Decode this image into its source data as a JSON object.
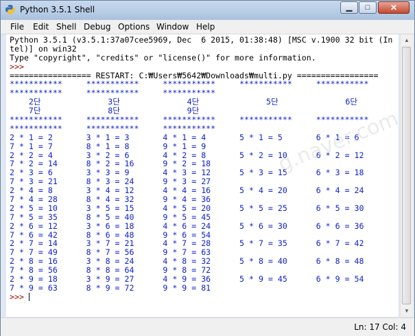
{
  "window": {
    "title": "Python 3.5.1 Shell"
  },
  "controls": {
    "minimize": "▁",
    "maximize": "□",
    "close": "✕"
  },
  "menu": [
    "File",
    "Edit",
    "Shell",
    "Debug",
    "Options",
    "Window",
    "Help"
  ],
  "watermark": "g.naver.com/nc",
  "console": [
    {
      "text": "Python 3.5.1 (v3.5.1:37a07cee5969, Dec  6 2015, 01:38:48) [MSC v.1900 32 bit (In",
      "style": "plain"
    },
    {
      "text": "tel)] on win32",
      "style": "plain"
    },
    {
      "text": "Type \"copyright\", \"credits\" or \"license()\" for more information.",
      "style": "plain"
    },
    {
      "text": ">>> ",
      "style": "prompt"
    },
    {
      "text": "================= RESTART: C:₩Users₩5642₩Downloads₩multi.py =================",
      "style": "plain"
    },
    {
      "text": "***********     ***********     ***********     ***********     ***********",
      "style": "out"
    },
    {
      "text": "***********     ***********     ***********",
      "style": "out"
    },
    {
      "text": "    2단              3단              4단              5단              6단",
      "style": "out"
    },
    {
      "text": "    7단              8단              9단",
      "style": "out"
    },
    {
      "text": "***********     ***********     ***********     ***********     ***********",
      "style": "out"
    },
    {
      "text": "***********     ***********     ***********",
      "style": "out"
    },
    {
      "text": "2 * 1 = 2       3 * 1 = 3       4 * 1 = 4       5 * 1 = 5       6 * 1 = 6",
      "style": "out"
    },
    {
      "text": "7 * 1 = 7       8 * 1 = 8       9 * 1 = 9",
      "style": "out"
    },
    {
      "text": "2 * 2 = 4       3 * 2 = 6       4 * 2 = 8       5 * 2 = 10      6 * 2 = 12",
      "style": "out"
    },
    {
      "text": "7 * 2 = 14      8 * 2 = 16      9 * 2 = 18",
      "style": "out"
    },
    {
      "text": "2 * 3 = 6       3 * 3 = 9       4 * 3 = 12      5 * 3 = 15      6 * 3 = 18",
      "style": "out"
    },
    {
      "text": "7 * 3 = 21      8 * 3 = 24      9 * 3 = 27",
      "style": "out"
    },
    {
      "text": "2 * 4 = 8       3 * 4 = 12      4 * 4 = 16      5 * 4 = 20      6 * 4 = 24",
      "style": "out"
    },
    {
      "text": "7 * 4 = 28      8 * 4 = 32      9 * 4 = 36",
      "style": "out"
    },
    {
      "text": "2 * 5 = 10      3 * 5 = 15      4 * 5 = 20      5 * 5 = 25      6 * 5 = 30",
      "style": "out"
    },
    {
      "text": "7 * 5 = 35      8 * 5 = 40      9 * 5 = 45",
      "style": "out"
    },
    {
      "text": "2 * 6 = 12      3 * 6 = 18      4 * 6 = 24      5 * 6 = 30      6 * 6 = 36",
      "style": "out"
    },
    {
      "text": "7 * 6 = 42      8 * 6 = 48      9 * 6 = 54",
      "style": "out"
    },
    {
      "text": "2 * 7 = 14      3 * 7 = 21      4 * 7 = 28      5 * 7 = 35      6 * 7 = 42",
      "style": "out"
    },
    {
      "text": "7 * 7 = 49      8 * 7 = 56      9 * 7 = 63",
      "style": "out"
    },
    {
      "text": "2 * 8 = 16      3 * 8 = 24      4 * 8 = 32      5 * 8 = 40      6 * 8 = 48",
      "style": "out"
    },
    {
      "text": "7 * 8 = 56      8 * 8 = 64      9 * 8 = 72",
      "style": "out"
    },
    {
      "text": "2 * 9 = 18      3 * 9 = 27      4 * 9 = 36      5 * 9 = 45      6 * 9 = 54",
      "style": "out"
    },
    {
      "text": "7 * 9 = 63      8 * 9 = 72      9 * 9 = 81",
      "style": "out"
    },
    {
      "text": ">>> ",
      "style": "prompt",
      "cursor": true
    }
  ],
  "status": {
    "line": "Ln: 17",
    "col": "Col: 4"
  }
}
